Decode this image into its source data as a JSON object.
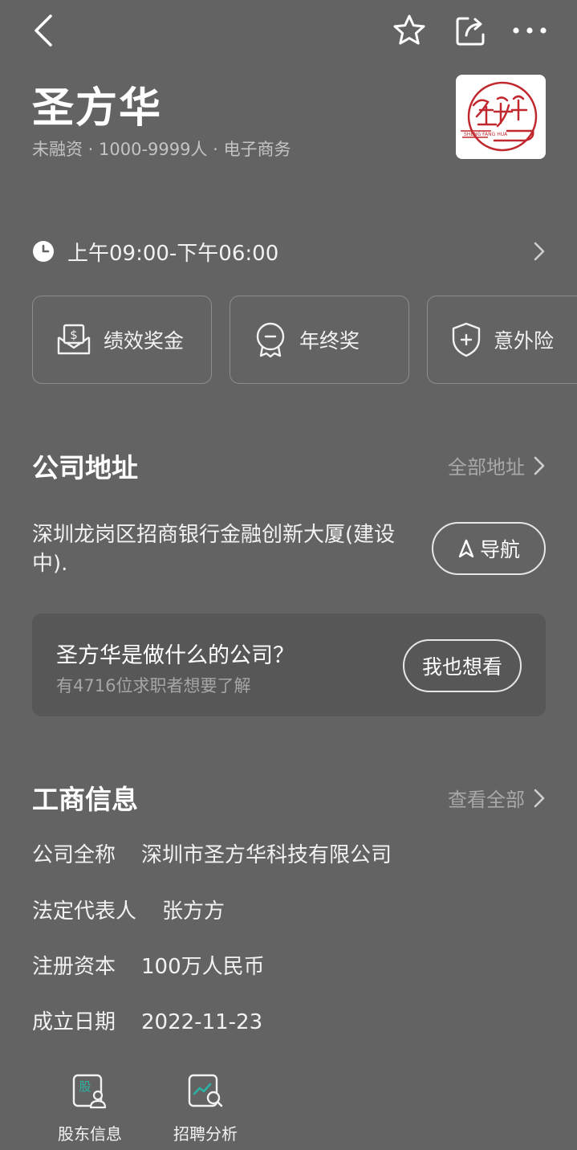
{
  "company": {
    "name": "圣方华",
    "meta": "未融资 · 1000-9999人 · 电子商务",
    "logo_text": "SHENG FANG HUA"
  },
  "hours": {
    "text": "上午09:00-下午06:00"
  },
  "benefits": [
    {
      "label": "绩效奖金",
      "icon": "money-envelope-icon"
    },
    {
      "label": "年终奖",
      "icon": "medal-icon"
    },
    {
      "label": "意外险",
      "icon": "shield-plus-icon"
    }
  ],
  "address": {
    "title": "公司地址",
    "link": "全部地址",
    "text": "深圳龙岗区招商银行金融创新大厦(建设中).",
    "nav_label": "导航"
  },
  "qa": {
    "question": "圣方华是做什么的公司？",
    "sub": "有4716位求职者想要了解",
    "button": "我也想看"
  },
  "business": {
    "title": "工商信息",
    "link": "查看全部",
    "rows": [
      {
        "label": "公司全称",
        "value": "深圳市圣方华科技有限公司"
      },
      {
        "label": "法定代表人",
        "value": "张方方"
      },
      {
        "label": "注册资本",
        "value": "100万人民币"
      },
      {
        "label": "成立日期",
        "value": "2022-11-23"
      }
    ]
  },
  "tools": [
    {
      "label": "股东信息",
      "icon": "shareholder-icon",
      "icon_char": "股"
    },
    {
      "label": "招聘分析",
      "icon": "recruit-analysis-icon"
    }
  ],
  "colors": {
    "background": "#636363",
    "card": "#575757",
    "accent_teal": "#2bb3a3",
    "logo_red": "#c0282e"
  }
}
